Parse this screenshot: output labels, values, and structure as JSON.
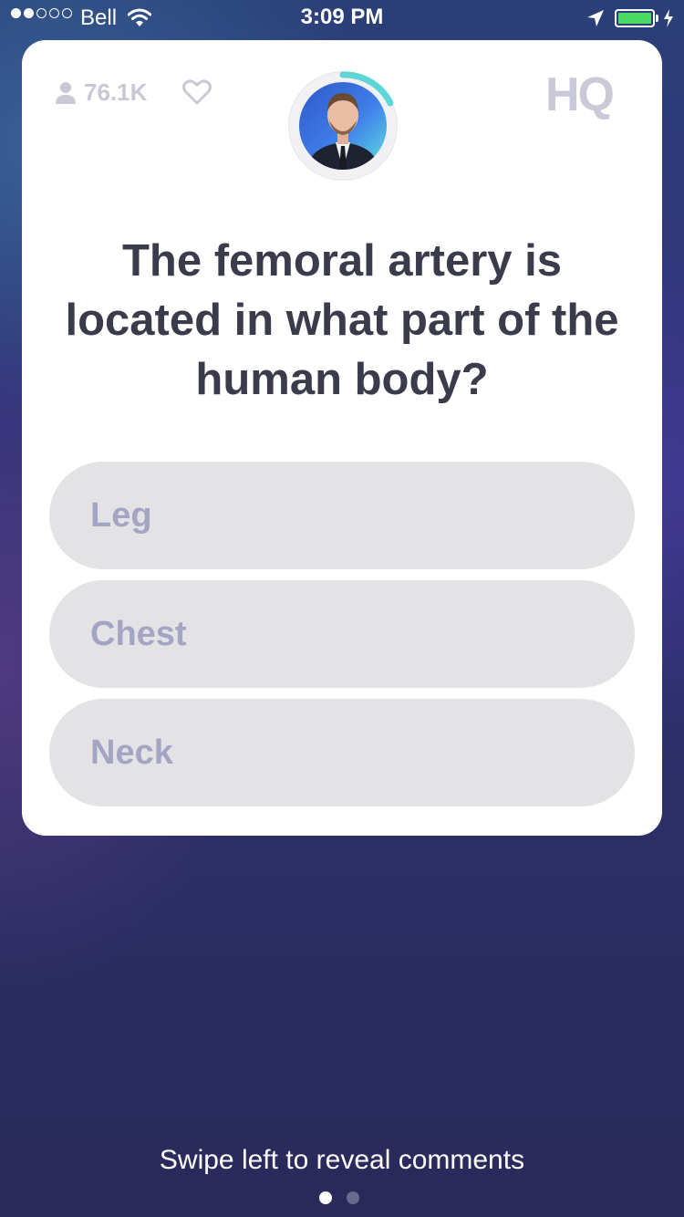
{
  "status_bar": {
    "carrier": "Bell",
    "time": "3:09 PM",
    "signal_bars_filled": 2,
    "signal_bars_total": 5,
    "battery_color": "#4cd964"
  },
  "game": {
    "viewer_count": "76.1K",
    "logo": "HQ",
    "question": "The femoral artery is located in what part of the human body?",
    "answers": [
      {
        "label": "Leg"
      },
      {
        "label": "Chest"
      },
      {
        "label": "Neck"
      }
    ],
    "timer_color": "#5fd6d6"
  },
  "footer": {
    "swipe_hint": "Swipe left to reveal comments",
    "page_count": 2,
    "active_page": 1
  },
  "icons": [
    "signal-dots",
    "wifi-icon",
    "location-arrow-icon",
    "battery-icon",
    "charging-bolt-icon",
    "person-icon",
    "heart-icon"
  ]
}
